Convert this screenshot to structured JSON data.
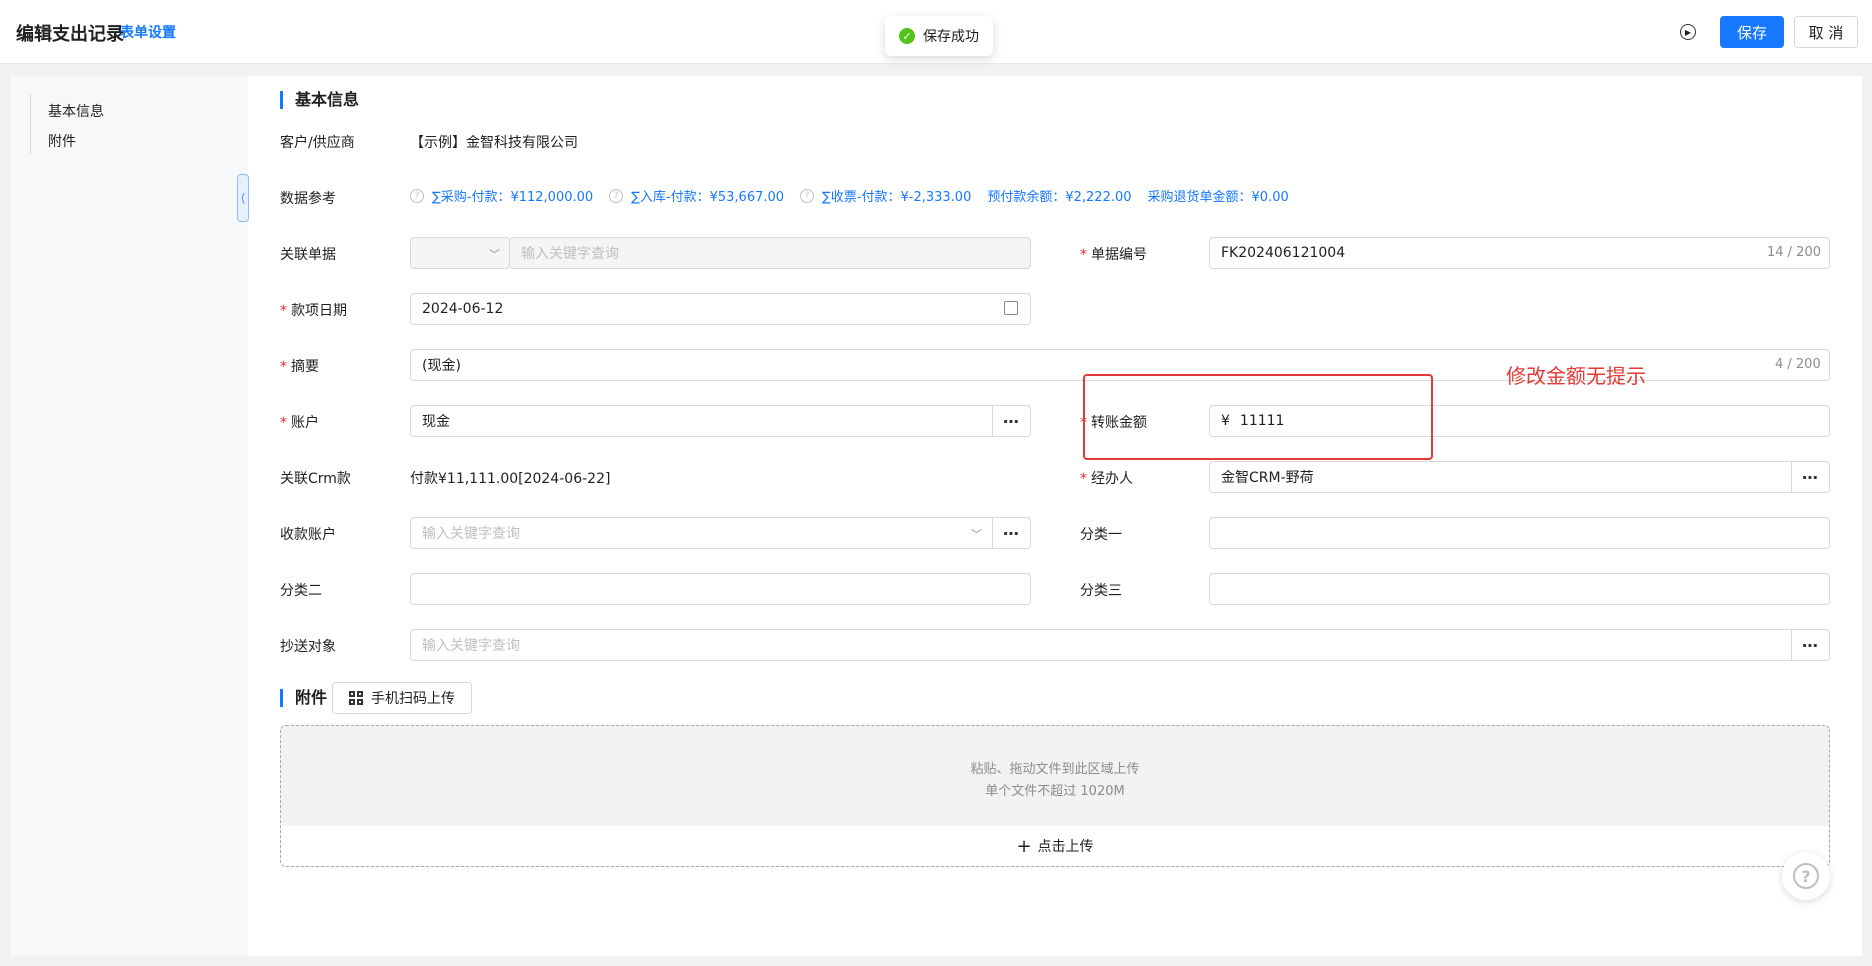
{
  "header": {
    "title": "编辑支出记录",
    "form_settings": "表单设置",
    "save": "保存",
    "cancel": "取 消",
    "help_icon": "play-circle-icon"
  },
  "toast": {
    "text": "保存成功",
    "icon": "check-circle-icon"
  },
  "sidebar": {
    "items": [
      {
        "label": "基本信息"
      },
      {
        "label": "附件"
      }
    ]
  },
  "sections": {
    "basic": "基本信息",
    "attachments": "附件"
  },
  "fields": {
    "customer": {
      "label": "客户/供应商",
      "value": "【示例】金智科技有限公司"
    },
    "data_ref": {
      "label": "数据参考",
      "items": [
        {
          "text": "∑采购-付款：¥112,000.00",
          "has_help": true
        },
        {
          "text": "∑入库-付款：¥53,667.00",
          "has_help": true
        },
        {
          "text": "∑收票-付款：¥-2,333.00",
          "has_help": true
        },
        {
          "text": "预付款余额：¥2,222.00",
          "has_help": false
        },
        {
          "text": "采购退货单金额：¥0.00",
          "has_help": false
        }
      ]
    },
    "related_doc": {
      "label": "关联单据",
      "placeholder": "输入关键字查询"
    },
    "doc_no": {
      "label": "单据编号",
      "value": "FK202406121004",
      "counter": "14 / 200"
    },
    "date": {
      "label": "款项日期",
      "value": "2024-06-12"
    },
    "summary": {
      "label": "摘要",
      "value": "(现金)",
      "counter": "4 / 200"
    },
    "account": {
      "label": "账户",
      "value": "现金"
    },
    "amount": {
      "label": "转账金额",
      "currency": "¥",
      "value": "11111"
    },
    "crm": {
      "label": "关联Crm款",
      "value": "付款¥11,111.00[2024-06-22]"
    },
    "handler": {
      "label": "经办人",
      "value": "金智CRM-野荷"
    },
    "payee_account": {
      "label": "收款账户",
      "placeholder": "输入关键字查询"
    },
    "category1": {
      "label": "分类一",
      "value": ""
    },
    "category2": {
      "label": "分类二",
      "value": ""
    },
    "category3": {
      "label": "分类三",
      "value": ""
    },
    "cc": {
      "label": "抄送对象",
      "placeholder": "输入关键字查询"
    }
  },
  "annotation": "修改金额无提示",
  "upload": {
    "qr_button": "手机扫码上传",
    "hint1": "粘贴、拖动文件到此区域上传",
    "hint2": "单个文件不超过 1020M",
    "click_upload": "点击上传"
  },
  "colors": {
    "primary": "#1677ff",
    "required": "#f5222d",
    "annotation": "#e53935",
    "success": "#52c41a"
  }
}
